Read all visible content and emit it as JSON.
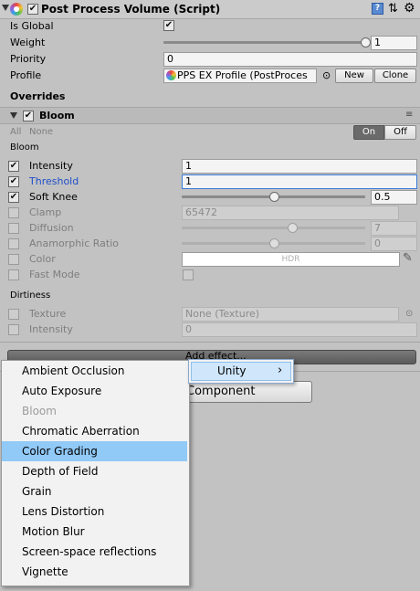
{
  "header": {
    "title": "Post Process Volume (Script)",
    "enabled": true
  },
  "props": {
    "is_global_label": "Is Global",
    "is_global": true,
    "weight_label": "Weight",
    "weight_value": "1",
    "weight_slider": 1.0,
    "priority_label": "Priority",
    "priority_value": "0",
    "profile_label": "Profile",
    "profile_value": "PPS EX Profile (PostProces",
    "new_label": "New",
    "clone_label": "Clone"
  },
  "overrides": {
    "title": "Overrides",
    "effect_name": "Bloom",
    "all_label": "All",
    "none_label": "None",
    "on_label": "On",
    "off_label": "Off"
  },
  "bloom": {
    "group_label": "Bloom",
    "rows": [
      {
        "label": "Intensity",
        "value": "1",
        "checked": true,
        "enabled": true
      },
      {
        "label": "Threshold",
        "value": "1",
        "checked": true,
        "enabled": true
      },
      {
        "label": "Soft Knee",
        "value": "0.5",
        "checked": true,
        "enabled": true,
        "slider": 0.5
      },
      {
        "label": "Clamp",
        "value": "65472",
        "checked": false,
        "enabled": false
      },
      {
        "label": "Diffusion",
        "value": "7",
        "checked": false,
        "enabled": false,
        "slider": 0.6
      },
      {
        "label": "Anamorphic Ratio",
        "value": "0",
        "checked": false,
        "enabled": false,
        "slider": 0.5
      },
      {
        "label": "Color",
        "value": "HDR",
        "checked": false,
        "enabled": false
      },
      {
        "label": "Fast Mode",
        "value": "",
        "checked": false,
        "enabled": false
      }
    ]
  },
  "dirtiness": {
    "group_label": "Dirtiness",
    "rows": [
      {
        "label": "Texture",
        "value": "None (Texture)",
        "checked": false
      },
      {
        "label": "Intensity",
        "value": "0",
        "checked": false
      }
    ]
  },
  "add_effect": {
    "label": "Add effect...",
    "add_component_label": "Component"
  },
  "menu": {
    "items": [
      {
        "label": "Ambient Occlusion",
        "disabled": false,
        "selected": false
      },
      {
        "label": "Auto Exposure",
        "disabled": false,
        "selected": false
      },
      {
        "label": "Bloom",
        "disabled": true,
        "selected": false
      },
      {
        "label": "Chromatic Aberration",
        "disabled": false,
        "selected": false
      },
      {
        "label": "Color Grading",
        "disabled": false,
        "selected": true
      },
      {
        "label": "Depth of Field",
        "disabled": false,
        "selected": false
      },
      {
        "label": "Grain",
        "disabled": false,
        "selected": false
      },
      {
        "label": "Lens Distortion",
        "disabled": false,
        "selected": false
      },
      {
        "label": "Motion Blur",
        "disabled": false,
        "selected": false
      },
      {
        "label": "Screen-space reflections",
        "disabled": false,
        "selected": false
      },
      {
        "label": "Vignette",
        "disabled": false,
        "selected": false
      }
    ],
    "submenu_label": "Unity",
    "submenu_arrow": "›"
  },
  "colors": {
    "panel_bg": "#c2c2c2",
    "highlight": "#91c9f7",
    "threshold_blue": "#1f4fc9"
  }
}
